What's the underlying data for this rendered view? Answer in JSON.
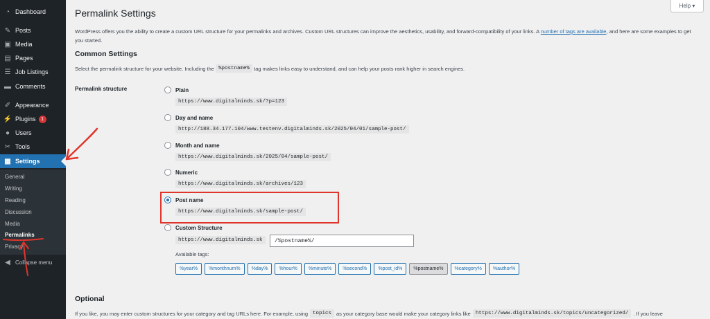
{
  "sidebar": {
    "items": [
      {
        "label": "Dashboard",
        "icon": "dashboard-icon"
      },
      {
        "label": "Posts",
        "icon": "pin-icon"
      },
      {
        "label": "Media",
        "icon": "media-icon"
      },
      {
        "label": "Pages",
        "icon": "page-icon"
      },
      {
        "label": "Job Listings",
        "icon": "list-icon"
      },
      {
        "label": "Comments",
        "icon": "comment-icon"
      },
      {
        "label": "Appearance",
        "icon": "brush-icon"
      },
      {
        "label": "Plugins",
        "icon": "plug-icon",
        "badge": "1"
      },
      {
        "label": "Users",
        "icon": "user-icon"
      },
      {
        "label": "Tools",
        "icon": "wrench-icon"
      },
      {
        "label": "Settings",
        "icon": "settings-icon"
      }
    ],
    "submenu": [
      "General",
      "Writing",
      "Reading",
      "Discussion",
      "Media",
      "Permalinks",
      "Privacy"
    ],
    "collapse_label": "Collapse menu"
  },
  "header": {
    "help_label": "Help ▾",
    "title": "Permalink Settings"
  },
  "intro": {
    "text_before": "WordPress offers you the ability to create a custom URL structure for your permalinks and archives. Custom URL structures can improve the aesthetics, usability, and forward-compatibility of your links. A ",
    "link_text": "number of tags are available",
    "text_after": ", and here are some examples to get you started."
  },
  "common": {
    "heading": "Common Settings",
    "desc_before": "Select the permalink structure for your website. Including the",
    "desc_code": "%postname%",
    "desc_after": "tag makes links easy to understand, and can help your posts rank higher in search engines.",
    "row_label": "Permalink structure",
    "options": [
      {
        "label": "Plain",
        "example": "https://www.digitalminds.sk/?p=123",
        "checked": false
      },
      {
        "label": "Day and name",
        "example": "http://188.34.177.104/www.testenv.digitalminds.sk/2025/04/01/sample-post/",
        "checked": false
      },
      {
        "label": "Month and name",
        "example": "https://www.digitalminds.sk/2025/04/sample-post/",
        "checked": false
      },
      {
        "label": "Numeric",
        "example": "https://www.digitalminds.sk/archives/123",
        "checked": false
      },
      {
        "label": "Post name",
        "example": "https://www.digitalminds.sk/sample-post/",
        "checked": true
      },
      {
        "label": "Custom Structure",
        "example": "",
        "checked": false
      }
    ],
    "custom_prefix": "https://www.digitalminds.sk",
    "custom_value": "/%postname%/",
    "available_tags_label": "Available tags:",
    "tags": [
      "%year%",
      "%monthnum%",
      "%day%",
      "%hour%",
      "%minute%",
      "%second%",
      "%post_id%",
      "%postname%",
      "%category%",
      "%author%"
    ]
  },
  "optional": {
    "heading": "Optional",
    "desc_before": "If you like, you may enter custom structures for your category and tag URLs here. For example, using",
    "desc_code": "topics",
    "desc_middle": "as your category base would make your category links like",
    "desc_code2": "https://www.digitalminds.sk/topics/uncategorized/",
    "desc_after": ". If you leave"
  },
  "colors": {
    "sidebar_bg": "#1d2327",
    "accent": "#2271b1",
    "annotation_red": "#e0352b"
  }
}
